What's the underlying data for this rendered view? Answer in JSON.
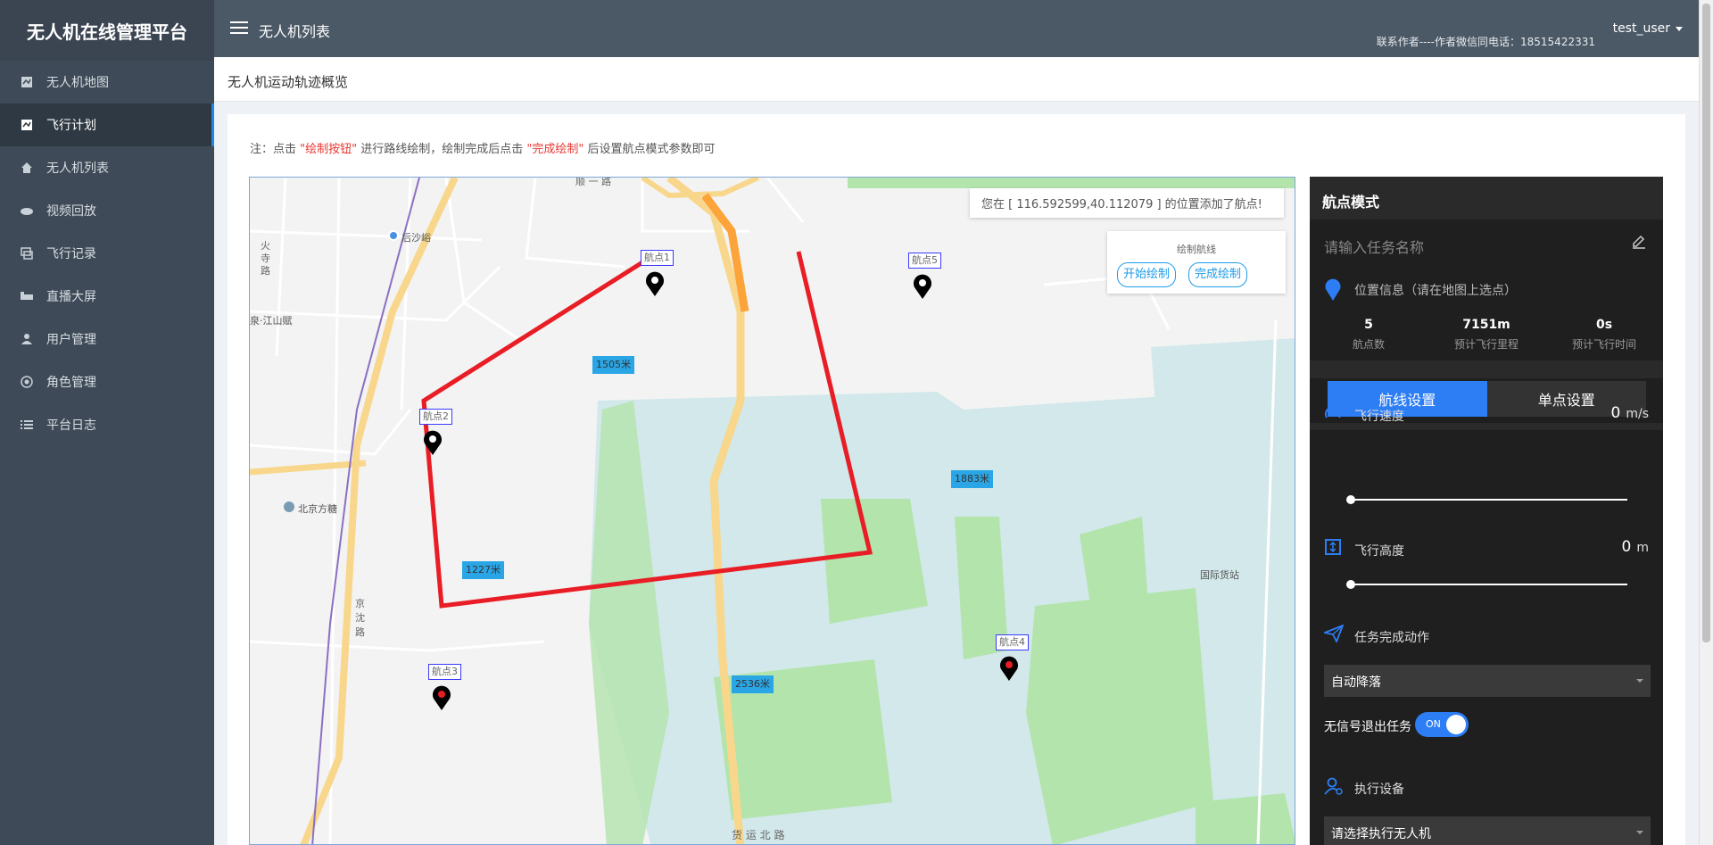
{
  "app": {
    "title": "无人机在线管理平台",
    "header_title": "无人机列表",
    "contact": "联系作者----作者微信同电话：18515422331",
    "user": "test_user"
  },
  "sidebar": {
    "items": [
      {
        "label": "无人机地图",
        "icon": "map-icon"
      },
      {
        "label": "飞行计划",
        "icon": "plan-icon"
      },
      {
        "label": "无人机列表",
        "icon": "home-icon"
      },
      {
        "label": "视频回放",
        "icon": "video-icon"
      },
      {
        "label": "飞行记录",
        "icon": "record-icon"
      },
      {
        "label": "直播大屏",
        "icon": "screen-icon"
      },
      {
        "label": "用户管理",
        "icon": "user-icon"
      },
      {
        "label": "角色管理",
        "icon": "role-icon"
      },
      {
        "label": "平台日志",
        "icon": "log-icon"
      }
    ],
    "active_index": 1
  },
  "page": {
    "title": "无人机运动轨迹概览",
    "note_prefix": "注：点击 ",
    "note_draw": "\"绘制按钮\"",
    "note_mid": " 进行路线绘制，绘制完成后点击 ",
    "note_finish": "\"完成绘制\"",
    "note_suffix": " 后设置航点模式参数即可"
  },
  "map": {
    "tip": "您在 [ 116.592599,40.112079 ] 的位置添加了航点!",
    "draw_title": "绘制航线",
    "start_draw": "开始绘制",
    "finish_draw": "完成绘制",
    "waypoints": [
      "航点1",
      "航点2",
      "航点3",
      "航点4",
      "航点5"
    ],
    "distances": [
      "1505米",
      "1227米",
      "2536米",
      "1883米"
    ],
    "place_labels": [
      "后沙峪",
      "北京方糖",
      "国际货站",
      "货 运 北 路",
      "火 寺 路",
      "泉·江山赋",
      "京 沈 路",
      "顺 一 路"
    ]
  },
  "panel": {
    "title": "航点模式",
    "task_placeholder": "请输入任务名称",
    "location_label": "位置信息（请在地图上选点）",
    "stats": [
      {
        "value": "5",
        "label": "航点数"
      },
      {
        "value": "7151m",
        "label": "预计飞行里程"
      },
      {
        "value": "0s",
        "label": "预计飞行时间"
      }
    ],
    "tabs": [
      "航线设置",
      "单点设置"
    ],
    "speed_label": "飞行速度",
    "speed_value": "0",
    "speed_unit": "m/s",
    "height_label": "飞行高度",
    "height_value": "0",
    "height_unit": "m",
    "action_label": "任务完成动作",
    "action_value": "自动降落",
    "no_signal_label": "无信号退出任务",
    "toggle_text": "ON",
    "device_label": "执行设备",
    "device_value": "请选择执行无人机",
    "accent": "#2d7ef5"
  }
}
